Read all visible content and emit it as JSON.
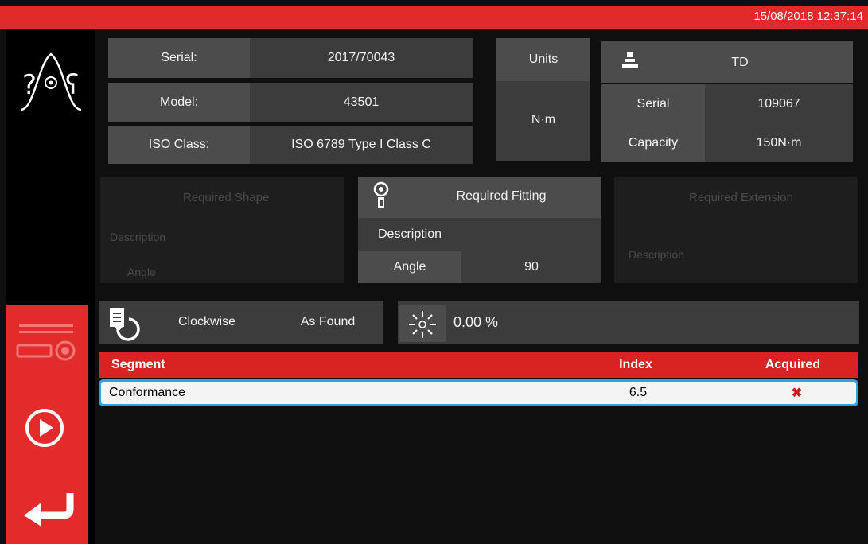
{
  "status": {
    "datetime": "15/08/2018 12:37:14"
  },
  "tool": {
    "serial_label": "Serial:",
    "serial_value": "2017/70043",
    "model_label": "Model:",
    "model_value": "43501",
    "iso_label": "ISO Class:",
    "iso_value": "ISO 6789 Type I Class C"
  },
  "units": {
    "label": "Units",
    "value": "N·m"
  },
  "transducer": {
    "name": "TD",
    "serial_label": "Serial",
    "serial_value": "109067",
    "capacity_label": "Capacity",
    "capacity_value": "150N·m"
  },
  "fitting_left": {
    "title": "Required Shape",
    "desc_label": "Description",
    "angle_label": "Angle"
  },
  "fitting": {
    "title": "Required Fitting",
    "desc_label": "Description",
    "angle_label": "Angle",
    "angle_value": "90"
  },
  "fitting_right": {
    "title": "Required Extension",
    "desc_label": "Description"
  },
  "test": {
    "direction": "Clockwise",
    "mode": "As Found",
    "percent": "0.00 %"
  },
  "table": {
    "headers": [
      "Segment",
      "Index",
      "Acquired"
    ],
    "rows": [
      {
        "segment": "Conformance",
        "index": "6.5",
        "acquired": "✖"
      }
    ]
  },
  "icons": {
    "logo": "bell-curve-logo-icon",
    "transducer": "transducer-icon",
    "fitting": "fitting-icon",
    "direction": "clockwise-doc-icon",
    "percent": "sparkle-icon",
    "connect": "connect-transducer-icon",
    "play": "play-icon",
    "back": "return-arrow-icon"
  },
  "colors": {
    "accent": "#e12a2a",
    "highlight": "#2aa5e4",
    "panel": "#3c3c3c"
  }
}
